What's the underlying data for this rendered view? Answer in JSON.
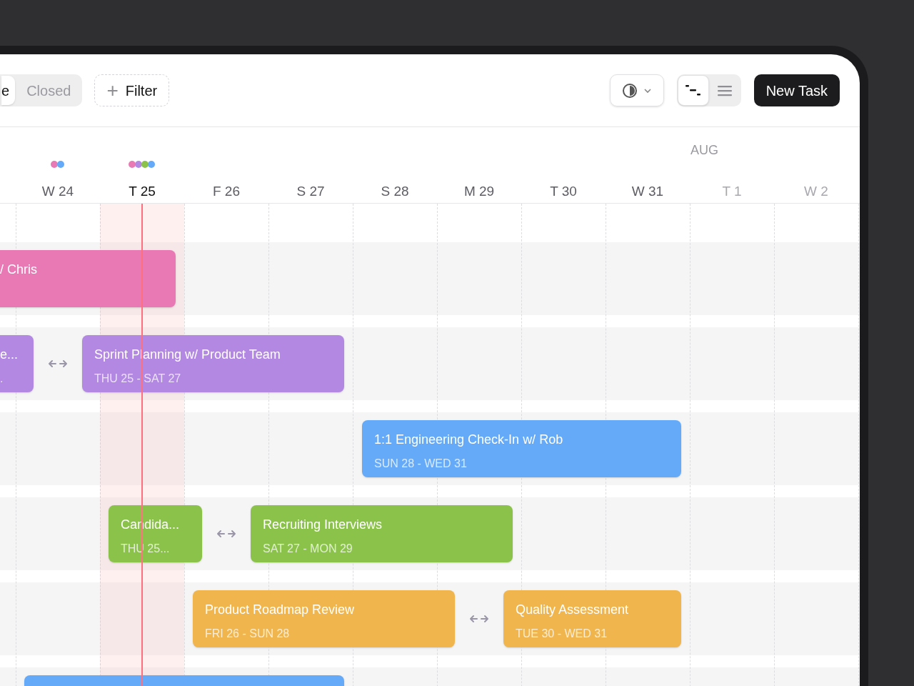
{
  "status_tabs": [
    {
      "label": "e",
      "selected": true
    },
    {
      "label": "Closed",
      "selected": false
    }
  ],
  "filter_button": {
    "icon": "+",
    "label": "Filter"
  },
  "view_toggle": [
    {
      "kind": "timeline",
      "selected": true
    },
    {
      "kind": "list",
      "selected": false
    }
  ],
  "new_task_button": "New Task",
  "month_label": "AUG",
  "days": [
    {
      "label": "W 24",
      "selected": false,
      "muted": false,
      "markers": [
        {
          "color": "#e879b4"
        },
        {
          "color": "#64aaf9"
        }
      ]
    },
    {
      "label": "T 25",
      "selected": true,
      "muted": false,
      "markers": [
        {
          "color": "#e879b4"
        },
        {
          "color": "#b388e3"
        },
        {
          "color": "#8bc34a"
        },
        {
          "color": "#64aaf9"
        }
      ]
    },
    {
      "label": "F 26",
      "selected": false,
      "muted": false
    },
    {
      "label": "S 27",
      "selected": false,
      "muted": false
    },
    {
      "label": "S 28",
      "selected": false,
      "muted": false
    },
    {
      "label": "M 29",
      "selected": false,
      "muted": false
    },
    {
      "label": "T 30",
      "selected": false,
      "muted": false
    },
    {
      "label": "W 31",
      "selected": false,
      "muted": false
    },
    {
      "label": "T 1",
      "selected": false,
      "muted": true
    },
    {
      "label": "W 2",
      "selected": false,
      "muted": true
    }
  ],
  "rows": [
    {
      "linked": false,
      "tasks": [
        {
          "title": "/ Chris",
          "color": "#e879b4"
        }
      ]
    },
    {
      "linked": true,
      "tasks": [
        {
          "title": "e...",
          "dates": ".",
          "color": "#b388e3"
        },
        {
          "title": "Sprint Planning w/ Product Team",
          "dates": "THU 25 - SAT 27",
          "color": "#b388e3"
        }
      ]
    },
    {
      "linked": false,
      "tasks": [
        {
          "title": "1:1 Engineering Check-In w/ Rob",
          "dates": "SUN 28 - WED 31",
          "color": "#64aaf9"
        }
      ]
    },
    {
      "linked": true,
      "tasks": [
        {
          "title": "Candida...",
          "dates": "THU 25...",
          "color": "#8bc34a"
        },
        {
          "title": "Recruiting Interviews",
          "dates": "SAT 27 - MON 29",
          "color": "#8bc34a"
        }
      ]
    },
    {
      "linked": true,
      "tasks": [
        {
          "title": "Product Roadmap Review",
          "dates": "FRI 26 - SUN 28",
          "color": "#f0b54d"
        },
        {
          "title": "Quality Assessment",
          "dates": "TUE 30 - WED 31",
          "color": "#f0b54d"
        }
      ]
    },
    {
      "linked": false,
      "tasks": [
        {
          "color": "#64aaf9"
        }
      ]
    }
  ]
}
